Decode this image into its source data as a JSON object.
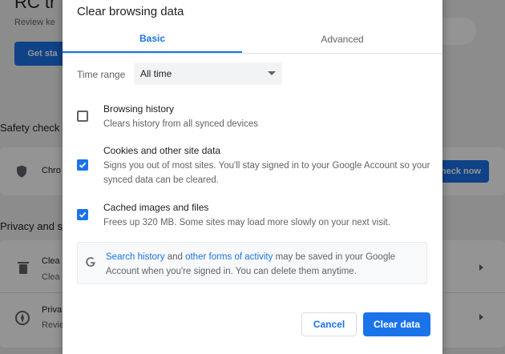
{
  "background": {
    "heading_fragment": "RC tr",
    "subtitle_fragment": "Review ke",
    "get_started_label": "Get sta",
    "safety_check_label": "Safety check",
    "chrome_row_label": "Chro",
    "check_now_label": "Check now",
    "privacy_label": "Privacy and s",
    "clear_row_label": "Clea",
    "clear_row_sub": "Clea",
    "privacy_row_label": "Priva",
    "privacy_row_sub": "Revie"
  },
  "dialog": {
    "title": "Clear browsing data",
    "tabs": [
      {
        "label": "Basic",
        "active": true
      },
      {
        "label": "Advanced",
        "active": false
      }
    ],
    "time_range": {
      "label": "Time range",
      "value": "All time"
    },
    "options": [
      {
        "title": "Browsing history",
        "description": "Clears history from all synced devices",
        "checked": false
      },
      {
        "title": "Cookies and other site data",
        "description": "Signs you out of most sites. You'll stay signed in to your Google Account so your synced data can be cleared.",
        "checked": true
      },
      {
        "title": "Cached images and files",
        "description": "Frees up 320 MB. Some sites may load more slowly on your next visit.",
        "checked": true
      }
    ],
    "info": {
      "link1": "Search history",
      "mid1": " and ",
      "link2": "other forms of activity",
      "rest": " may be saved in your Google Account when you're signed in. You can delete them anytime."
    },
    "cancel_label": "Cancel",
    "clear_label": "Clear data"
  },
  "colors": {
    "accent": "#1a73e8",
    "text": "#202124",
    "secondary_text": "#5f6368"
  }
}
